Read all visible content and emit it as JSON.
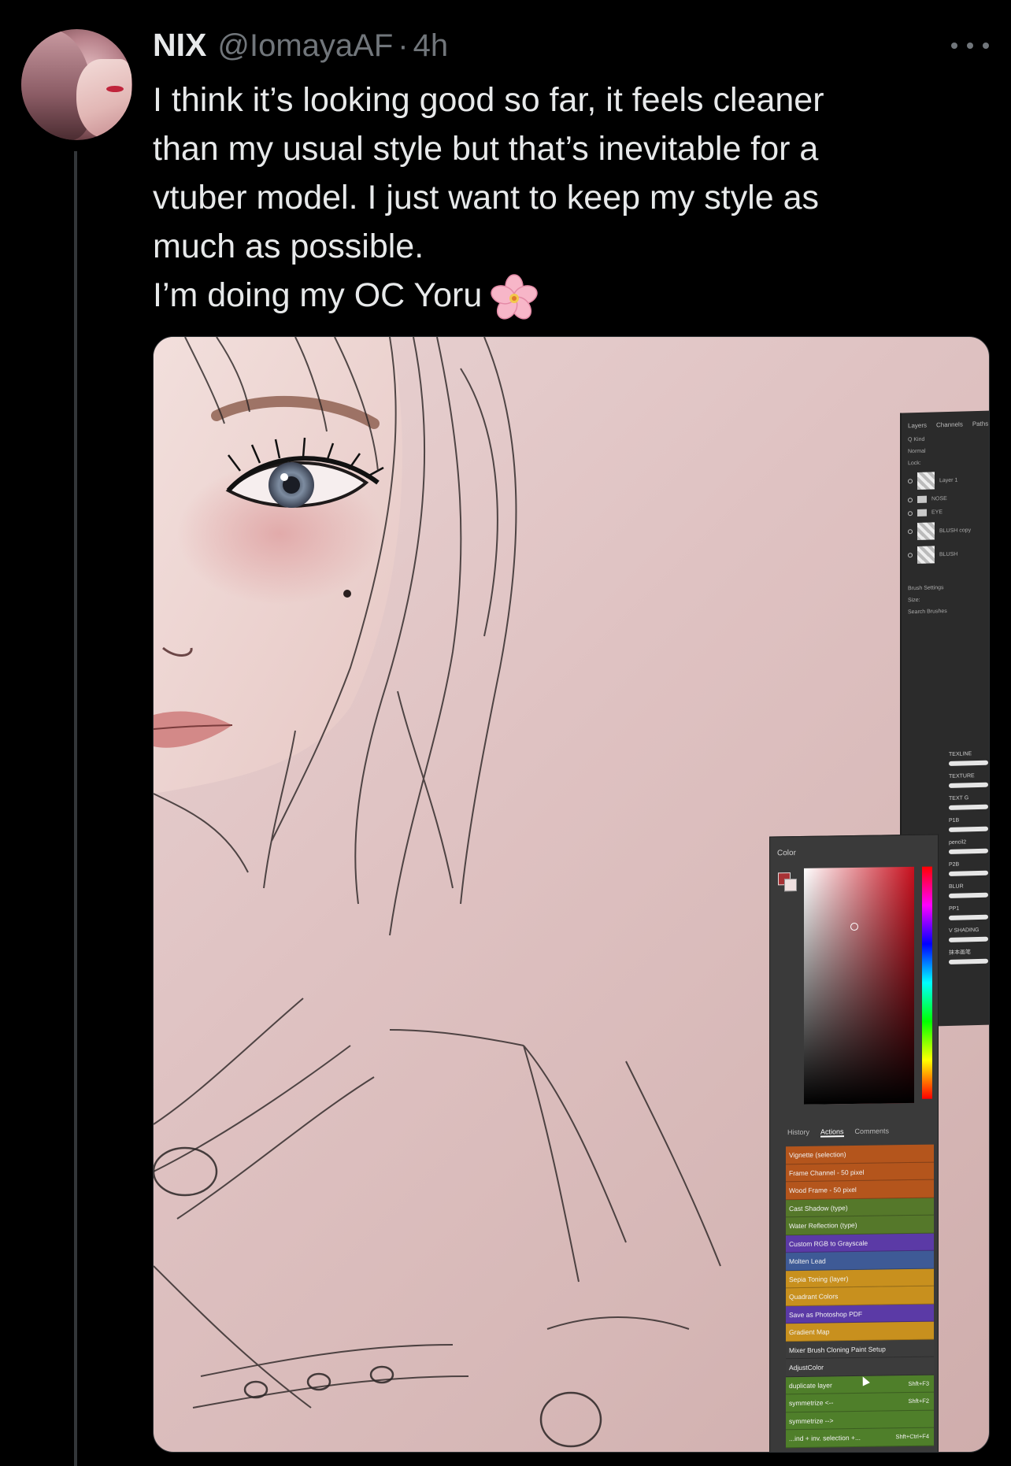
{
  "post": {
    "display_name": "NIX",
    "handle": "@IomayaAF",
    "separator": "·",
    "time": "4h",
    "text_lines": [
      "I think it’s looking good so far, it feels cleaner",
      "than my usual style but that’s inevitable for a",
      "vtuber model. I just want to keep my style as",
      "much as possible.",
      "I’m doing my OC Yoru"
    ],
    "emoji": "cherry-blossom-icon"
  },
  "photoshop": {
    "layers_panel": {
      "tabs": [
        "Layers",
        "Channels",
        "Paths"
      ],
      "kind_label": "Q Kind",
      "blend_mode": "Normal",
      "lock_label": "Lock:",
      "layers": [
        "Layer 1",
        "NOSE",
        "EYE",
        "BLUSH copy",
        "BLUSH"
      ],
      "brush_settings_label": "Brush Settings",
      "size_label": "Size:",
      "search_placeholder": "Search Brushes",
      "brushes": [
        "TEXLINE",
        "TEXTURE",
        "TEXT G",
        "P1B",
        "pencil2",
        "P2B",
        "BLUR",
        "PP1",
        "V SHADING",
        "抹本画笔"
      ]
    },
    "color_panel": {
      "title": "Color",
      "foreground": "#a83235",
      "background": "#f0e0e0"
    },
    "actions_panel": {
      "tabs": [
        "History",
        "Actions",
        "Comments"
      ],
      "active_tab": "Actions",
      "items": [
        {
          "label": "Vignette (selection)",
          "color": "#b4551c",
          "shortcut": ""
        },
        {
          "label": "Frame Channel - 50 pixel",
          "color": "#b4551c",
          "shortcut": ""
        },
        {
          "label": "Wood Frame - 50 pixel",
          "color": "#b4551c",
          "shortcut": ""
        },
        {
          "label": "Cast Shadow (type)",
          "color": "#55782a",
          "shortcut": ""
        },
        {
          "label": "Water Reflection (type)",
          "color": "#55782a",
          "shortcut": ""
        },
        {
          "label": "Custom RGB to Grayscale",
          "color": "#5b3aa6",
          "shortcut": ""
        },
        {
          "label": "Molten Lead",
          "color": "#3e5a96",
          "shortcut": ""
        },
        {
          "label": "Sepia Toning (layer)",
          "color": "#c8901e",
          "shortcut": ""
        },
        {
          "label": "Quadrant Colors",
          "color": "#c8901e",
          "shortcut": ""
        },
        {
          "label": "Save as Photoshop PDF",
          "color": "#5b3aa6",
          "shortcut": ""
        },
        {
          "label": "Gradient Map",
          "color": "#c8901e",
          "shortcut": ""
        },
        {
          "label": "Mixer Brush Cloning Paint Setup",
          "color": "#3c3c3c",
          "shortcut": ""
        },
        {
          "label": "AdjustColor",
          "color": "#3c3c3c",
          "shortcut": ""
        },
        {
          "label": "duplicate layer",
          "color": "#4f7f2a",
          "shortcut": "Shft+F3"
        },
        {
          "label": "symmetrize <--",
          "color": "#4f7f2a",
          "shortcut": "Shft+F2"
        },
        {
          "label": "symmetrize -->",
          "color": "#4f7f2a",
          "shortcut": ""
        },
        {
          "label": "...ind + inv. selection +...",
          "color": "#4f7f2a",
          "shortcut": "Shft+Ctrl+F4"
        }
      ]
    }
  }
}
